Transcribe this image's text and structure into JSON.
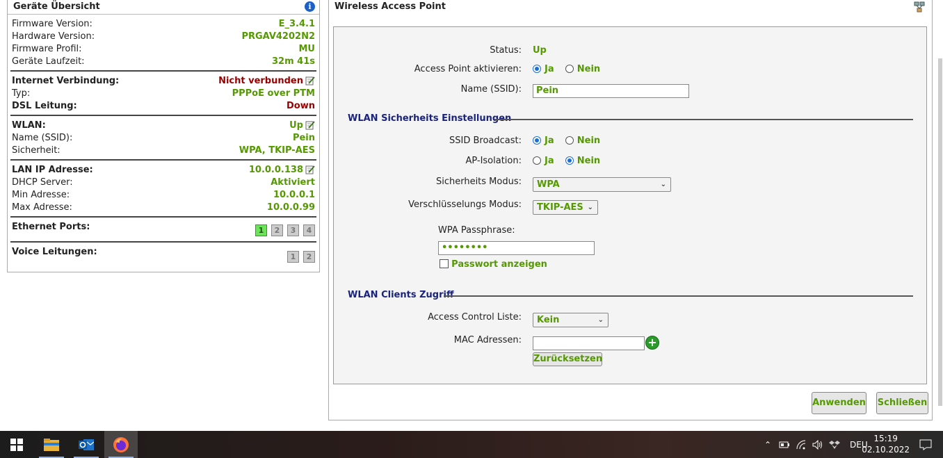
{
  "overview": {
    "title": "Geräte Übersicht",
    "firmware": [
      {
        "label": "Firmware Version:",
        "value": "E_3.4.1"
      },
      {
        "label": "Hardware Version:",
        "value": "PRGAV4202N2"
      },
      {
        "label": "Firmware Profil:",
        "value": "MU"
      },
      {
        "label": "Geräte Laufzeit:",
        "value": "32m 41s"
      }
    ],
    "internet": {
      "label": "Internet Verbindung:",
      "value": "Nicht verbunden",
      "typ_label": "Typ:",
      "typ_value": "PPPoE over PTM",
      "dsl_label": "DSL Leitung:",
      "dsl_value": "Down"
    },
    "wlan": {
      "label": "WLAN:",
      "value": "Up",
      "ssid_label": "Name (SSID):",
      "ssid_value": "Pein",
      "sec_label": "Sicherheit:",
      "sec_value": "WPA, TKIP-AES"
    },
    "lan": {
      "label": "LAN IP Adresse:",
      "value": "10.0.0.138",
      "dhcp_label": "DHCP Server:",
      "dhcp_value": "Aktiviert",
      "min_label": "Min Adresse:",
      "min_value": "10.0.0.1",
      "max_label": "Max Adresse:",
      "max_value": "10.0.0.99"
    },
    "ethernet": {
      "label": "Ethernet Ports:",
      "ports": [
        "1",
        "2",
        "3",
        "4"
      ],
      "active_port": "1"
    },
    "voice": {
      "label": "Voice Leitungen:",
      "lines": [
        "1",
        "2"
      ]
    }
  },
  "wap": {
    "title": "Wireless Access Point",
    "status_label": "Status:",
    "status_value": "Up",
    "ap_label": "Access Point aktivieren:",
    "ja": "Ja",
    "nein": "Nein",
    "ssid_label": "Name (SSID):",
    "ssid_value": "Pein",
    "sec_header": "WLAN Sicherheits Einstellungen",
    "bcast_label": "SSID Broadcast:",
    "iso_label": "AP-Isolation:",
    "secmode_label": "Sicherheits Modus:",
    "secmode_value": "WPA",
    "enc_label": "Verschlüsselungs Modus:",
    "enc_value": "TKIP-AES",
    "pass_label": "WPA Passphrase:",
    "pass_value": "••••••••",
    "show_pass_label": "Passwort anzeigen",
    "clients_header": "WLAN Clients Zugriff",
    "acl_label": "Access Control Liste:",
    "acl_value": "Kein",
    "mac_label": "MAC Adressen:",
    "mac_value": "",
    "reset_label": "Zurücksetzen",
    "apply_label": "Anwenden",
    "close_label": "Schließen"
  },
  "taskbar": {
    "lang": "DEU",
    "time": "15:19",
    "date": "02.10.2022"
  }
}
